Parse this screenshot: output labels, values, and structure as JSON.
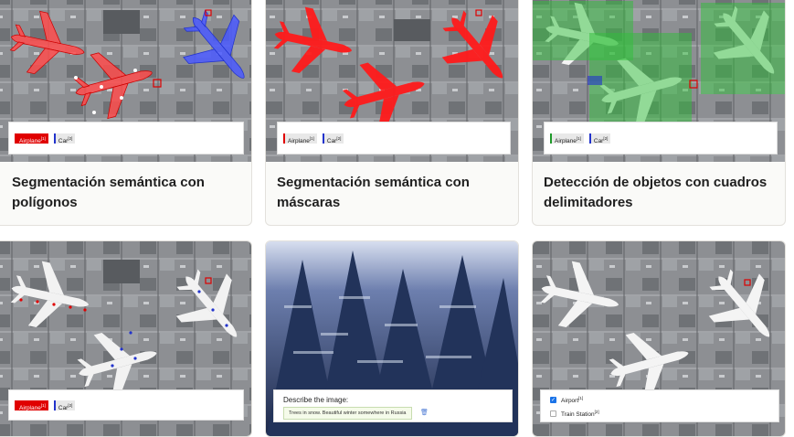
{
  "cards": [
    {
      "title": "Segmentación semántica con polígonos",
      "legend": [
        {
          "label": "Airplane",
          "count": "[1]",
          "style": "red-fill"
        },
        {
          "label": "Car",
          "count": "[2]",
          "style": "blue"
        }
      ]
    },
    {
      "title": "Segmentación semántica con máscaras",
      "legend": [
        {
          "label": "Airplane",
          "count": "[1]",
          "style": "red"
        },
        {
          "label": "Car",
          "count": "[2]",
          "style": "blue"
        }
      ]
    },
    {
      "title": "Detección de objetos con cuadros delimitadores",
      "legend": [
        {
          "label": "Airplane",
          "count": "[1]",
          "style": "green"
        },
        {
          "label": "Car",
          "count": "[2]",
          "style": "blue"
        }
      ]
    },
    {
      "title": "",
      "legend": [
        {
          "label": "Airplane",
          "count": "[1]",
          "style": "red-fill"
        },
        {
          "label": "Car",
          "count": "[2]",
          "style": "blue"
        }
      ]
    },
    {
      "title": "",
      "describe_label": "Describe the image:",
      "describe_value": "Trees in snow. Beautiful winter somewhere in Russia",
      "trash_icon": "trash-icon"
    },
    {
      "title": "",
      "options": [
        {
          "label": "Airport",
          "count": "[1]",
          "checked": true
        },
        {
          "label": "Train Station",
          "count": "[2]",
          "checked": false
        }
      ]
    }
  ],
  "colors": {
    "airplane_red": "#e00000",
    "car_blue": "#2233cc",
    "box_green": "#1f9a2a",
    "checkbox_blue": "#1a73e8"
  }
}
